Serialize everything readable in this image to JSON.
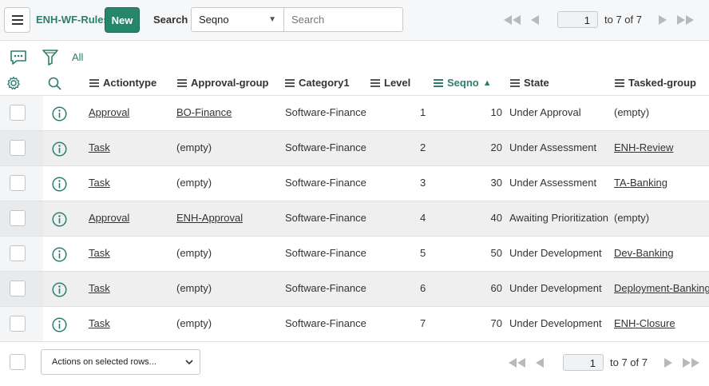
{
  "header": {
    "list_title": "ENH-WF-Rules",
    "new_label": "New",
    "search_label": "Search",
    "search_field": "Seqno",
    "search_placeholder": "Search"
  },
  "pager": {
    "page": "1",
    "range_label": "to 7 of 7"
  },
  "toolbar": {
    "all_label": "All"
  },
  "columns": [
    {
      "label": "Actiontype"
    },
    {
      "label": "Approval-group"
    },
    {
      "label": "Category1"
    },
    {
      "label": "Level"
    },
    {
      "label": "Seqno",
      "sorted": "ascending"
    },
    {
      "label": "State"
    },
    {
      "label": "Tasked-group"
    }
  ],
  "rows": [
    {
      "actiontype": "Approval",
      "approval_group": "BO-Finance",
      "category1": "Software-Finance",
      "level": "1",
      "seqno": "10",
      "state": "Under Approval",
      "tasked_group": "(empty)"
    },
    {
      "actiontype": "Task",
      "approval_group": "(empty)",
      "category1": "Software-Finance",
      "level": "2",
      "seqno": "20",
      "state": "Under Assessment",
      "tasked_group": "ENH-Review"
    },
    {
      "actiontype": "Task",
      "approval_group": "(empty)",
      "category1": "Software-Finance",
      "level": "3",
      "seqno": "30",
      "state": "Under Assessment",
      "tasked_group": "TA-Banking"
    },
    {
      "actiontype": "Approval",
      "approval_group": "ENH-Approval",
      "category1": "Software-Finance",
      "level": "4",
      "seqno": "40",
      "state": "Awaiting Prioritization",
      "tasked_group": "(empty)"
    },
    {
      "actiontype": "Task",
      "approval_group": "(empty)",
      "category1": "Software-Finance",
      "level": "5",
      "seqno": "50",
      "state": "Under Development",
      "tasked_group": "Dev-Banking"
    },
    {
      "actiontype": "Task",
      "approval_group": "(empty)",
      "category1": "Software-Finance",
      "level": "6",
      "seqno": "60",
      "state": "Under Development",
      "tasked_group": "Deployment-Banking"
    },
    {
      "actiontype": "Task",
      "approval_group": "(empty)",
      "category1": "Software-Finance",
      "level": "7",
      "seqno": "70",
      "state": "Under Development",
      "tasked_group": "ENH-Closure"
    }
  ],
  "footer": {
    "actions_label": "Actions on selected rows...",
    "page": "1",
    "range_label": "to 7 of 7"
  },
  "colors": {
    "accent": "#2e7d6e",
    "new_button": "#27856a",
    "header_bg": "#f6f7f8"
  }
}
